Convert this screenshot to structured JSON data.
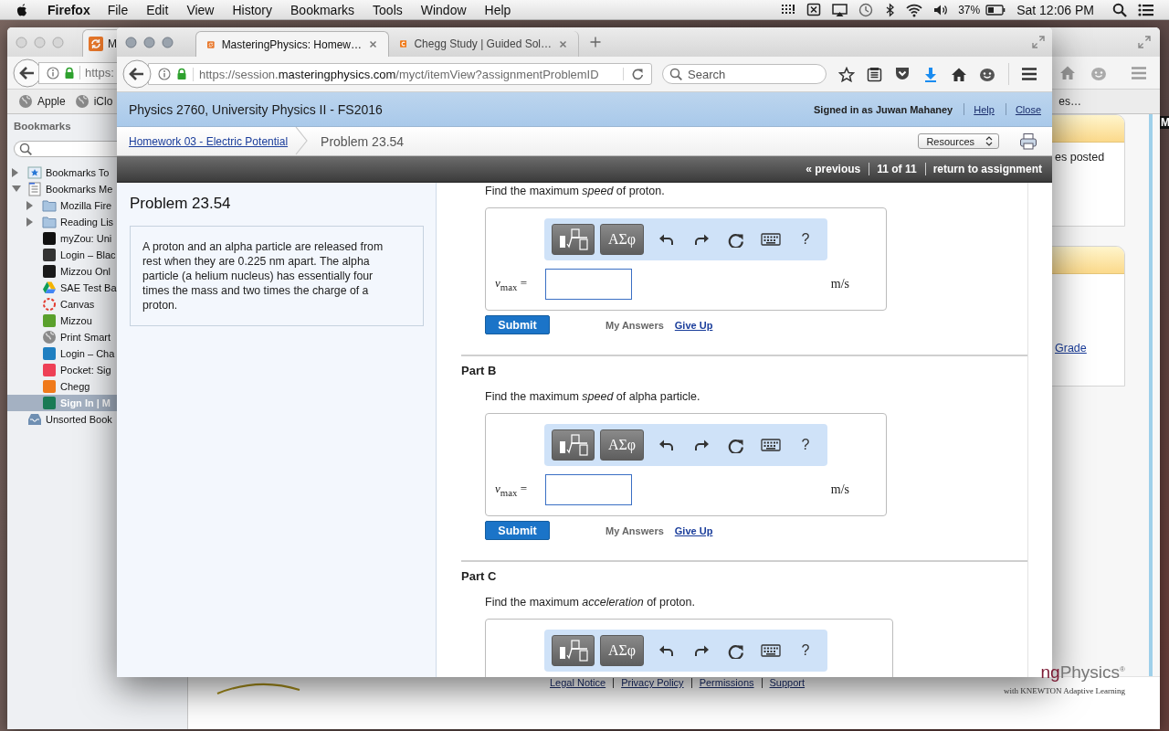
{
  "menubar": {
    "app": "Firefox",
    "menus": [
      "File",
      "Edit",
      "View",
      "History",
      "Bookmarks",
      "Tools",
      "Window",
      "Help"
    ],
    "battery": "37%",
    "clock": "Sat 12:06 PM"
  },
  "back_window": {
    "tab": "M",
    "url": "https:",
    "bookmarks_bar": [
      "Apple",
      "iClo"
    ],
    "bookmarks_bar_right": "es…",
    "sidebar": {
      "title": "Bookmarks",
      "items": [
        {
          "label": "Bookmarks To",
          "kind": "star-folder",
          "expanded": false,
          "selected": false
        },
        {
          "label": "Bookmarks Me",
          "kind": "menu-folder",
          "expanded": true,
          "selected": false,
          "children": [
            {
              "label": "Mozilla Fire",
              "kind": "folder",
              "expanded": false,
              "selected": false
            },
            {
              "label": "Reading Lis",
              "kind": "folder",
              "expanded": false,
              "selected": false
            },
            {
              "label": "myZou: Uni",
              "kind": "badge",
              "color": "#111111",
              "selected": false
            },
            {
              "label": "Login – Blac",
              "kind": "badge",
              "color": "#333333",
              "selected": false
            },
            {
              "label": "Mizzou Onl",
              "kind": "badge",
              "color": "#1a1a1a",
              "selected": false
            },
            {
              "label": "SAE Test Ba",
              "kind": "drive",
              "selected": false
            },
            {
              "label": "Canvas",
              "kind": "ring",
              "selected": false
            },
            {
              "label": "Mizzou",
              "kind": "badge",
              "color": "#5aa02c",
              "selected": false
            },
            {
              "label": "Print Smart",
              "kind": "globe",
              "selected": false
            },
            {
              "label": "Login – Cha",
              "kind": "badge",
              "color": "#1f7fc1",
              "selected": false
            },
            {
              "label": "Pocket: Sig",
              "kind": "badge",
              "color": "#ee4056",
              "selected": false
            },
            {
              "label": "Chegg",
              "kind": "badge",
              "color": "#f07a1a",
              "selected": false
            },
            {
              "label": "Sign In | M",
              "kind": "badge",
              "color": "#1a7a55",
              "selected": true
            }
          ]
        },
        {
          "label": "Unsorted Book",
          "kind": "unsorted",
          "selected": false
        }
      ]
    },
    "cards": [
      {
        "text": "es posted"
      },
      {
        "link": "Grade"
      }
    ],
    "footer_links": [
      "Legal Notice",
      "Privacy Policy",
      "Permissions",
      "Support"
    ],
    "logo": {
      "parts": [
        "ng",
        "Physics"
      ],
      "mark": "®",
      "tagline": "with KNEWTON Adaptive Learning"
    },
    "edge_label": "M"
  },
  "front_window": {
    "tabs": [
      {
        "label": "MasteringPhysics: Homew…",
        "kind": "mastering",
        "selected": true
      },
      {
        "label": "Chegg Study | Guided Sol…",
        "kind": "chegg",
        "selected": false
      }
    ],
    "url": {
      "scheme": "https://session.",
      "domain": "masteringphysics.com",
      "path": "/myct/itemView?assignmentProblemID"
    },
    "search": {
      "placeholder": "Search"
    },
    "header": {
      "course": "Physics 2760, University Physics II - FS2016",
      "signed_in": "Signed in as Juwan Mahaney",
      "links": [
        "Help",
        "Close"
      ]
    },
    "breadcrumb": {
      "link": "Homework 03 - Electric Potential",
      "current": "Problem 23.54",
      "resources": "Resources"
    },
    "nav": [
      "« previous",
      "11 of 11",
      "return to assignment"
    ],
    "problem": {
      "title": "Problem 23.54",
      "text": "A proton and an alpha particle are released from rest when they are 0.225 nm apart. The alpha particle (a helium nucleus) has essentially four times the mass and two times the charge of a proton."
    },
    "parts": [
      {
        "prompt": "Find the maximum *speed* of proton.",
        "toolbar": {
          "symbols": "ΑΣφ",
          "help": "?"
        },
        "answer": {
          "variable": "*v*$_{max}$ =",
          "unit": "m/s",
          "submit": "Submit",
          "my_answers": "My Answers",
          "give_up": "Give Up"
        }
      },
      {
        "heading": "Part B",
        "prompt": "Find the maximum *speed* of alpha particle.",
        "toolbar": {
          "symbols": "ΑΣφ",
          "help": "?"
        },
        "answer": {
          "variable": "*v*$_{max}$ =",
          "unit": "m/s",
          "submit": "Submit",
          "my_answers": "My Answers",
          "give_up": "Give Up"
        }
      },
      {
        "heading": "Part C",
        "prompt": "Find the maximum *acceleration* of proton.",
        "toolbar": {
          "symbols": "ΑΣφ",
          "help": "?"
        }
      }
    ]
  }
}
